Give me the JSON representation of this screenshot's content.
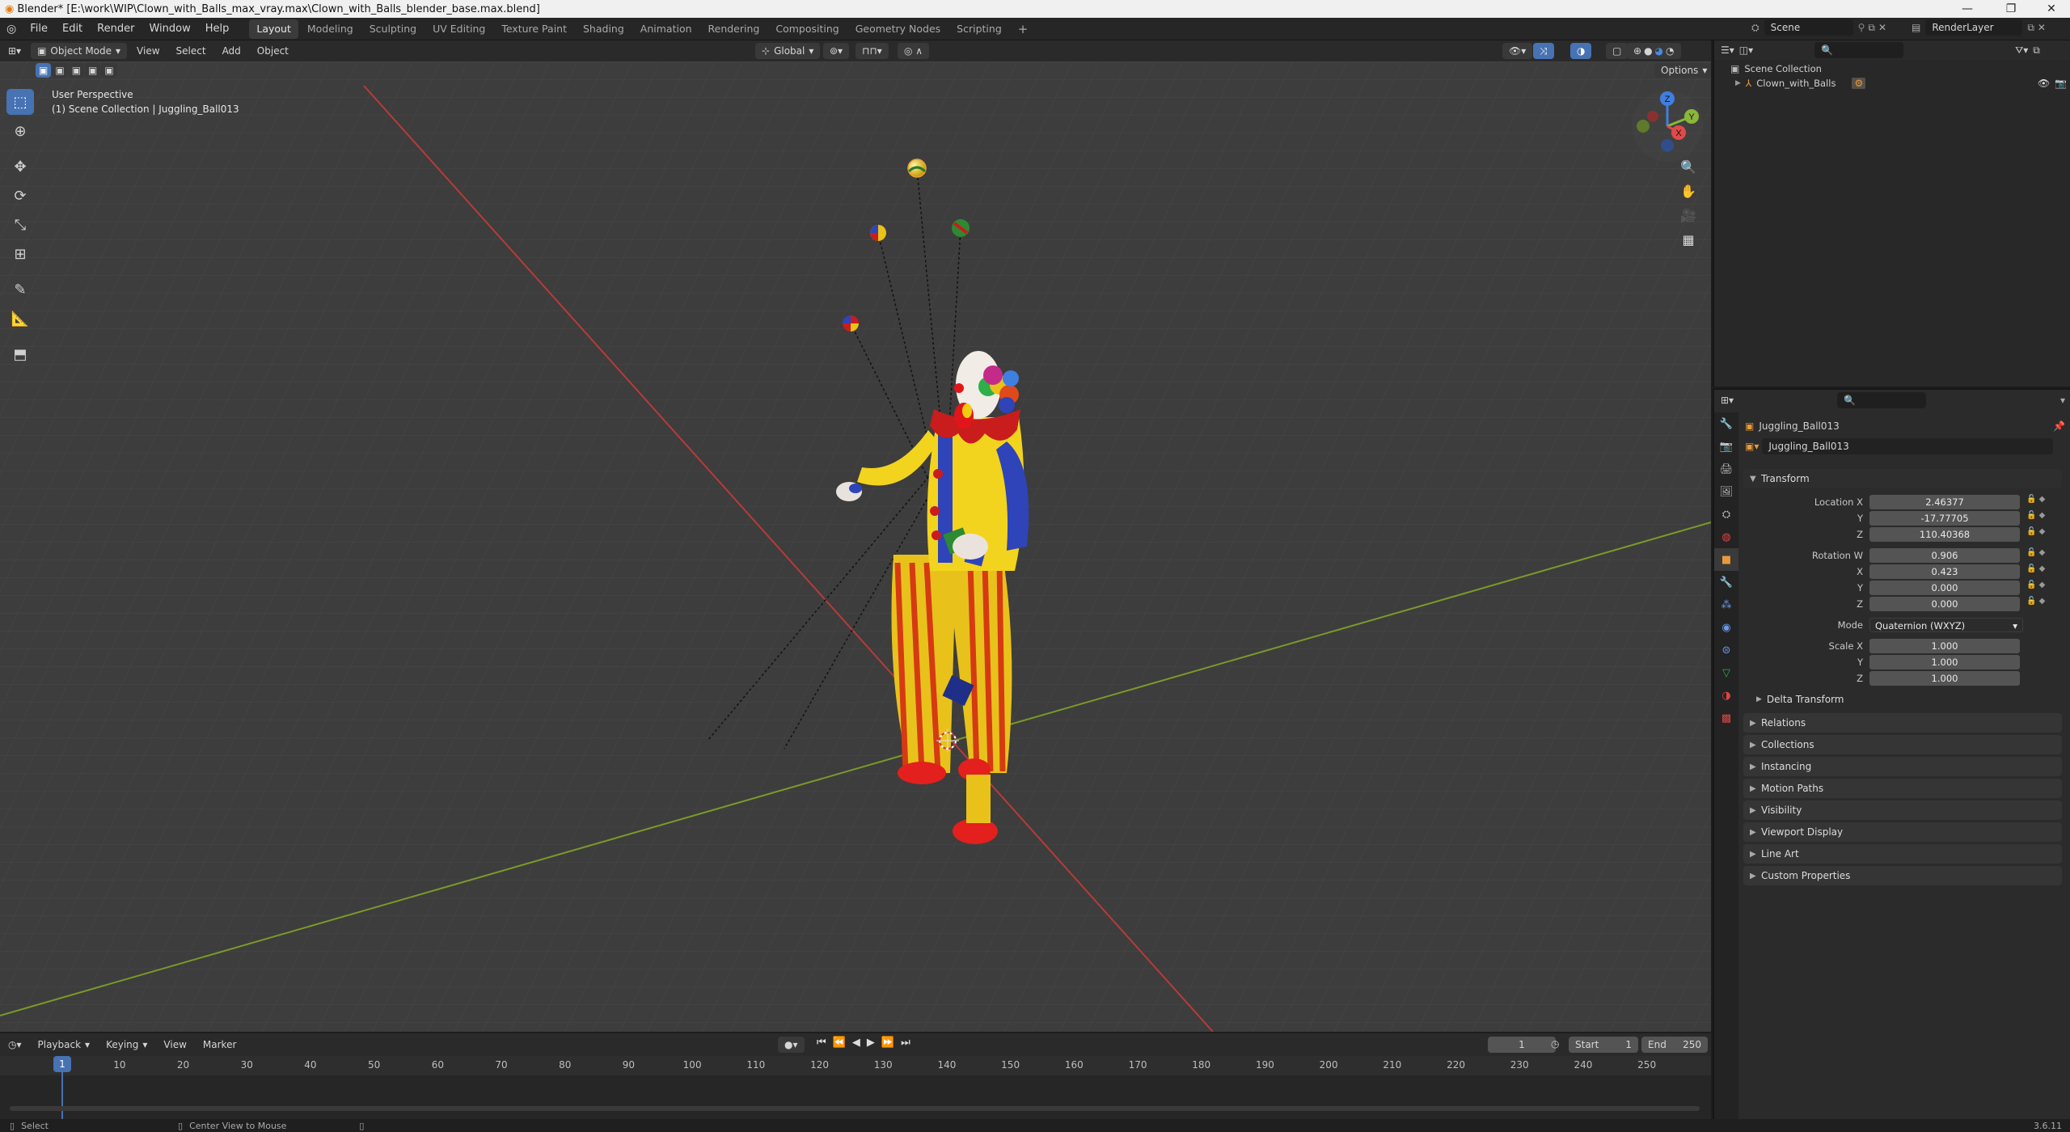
{
  "window": {
    "title": "Blender* [E:\\work\\WIP\\Clown_with_Balls_max_vray.max\\Clown_with_Balls_blender_base.max.blend]"
  },
  "menus": [
    "File",
    "Edit",
    "Render",
    "Window",
    "Help"
  ],
  "workspaces": [
    {
      "label": "Layout",
      "active": true
    },
    {
      "label": "Modeling",
      "active": false
    },
    {
      "label": "Sculpting",
      "active": false
    },
    {
      "label": "UV Editing",
      "active": false
    },
    {
      "label": "Texture Paint",
      "active": false
    },
    {
      "label": "Shading",
      "active": false
    },
    {
      "label": "Animation",
      "active": false
    },
    {
      "label": "Rendering",
      "active": false
    },
    {
      "label": "Compositing",
      "active": false
    },
    {
      "label": "Geometry Nodes",
      "active": false
    },
    {
      "label": "Scripting",
      "active": false
    }
  ],
  "scene_selector": {
    "scene": "Scene",
    "layer": "RenderLayer"
  },
  "viewport_header": {
    "mode": "Object Mode",
    "menus": [
      "View",
      "Select",
      "Add",
      "Object"
    ],
    "orientation": "Global",
    "options": "Options"
  },
  "viewport": {
    "overlay_line1": "User Perspective",
    "overlay_line2": "(1) Scene Collection | Juggling_Ball013",
    "gizmo_axes": [
      "X",
      "Y",
      "Z"
    ],
    "colors": {
      "x_axis": "#b83a3a",
      "y_axis": "#7a9a2a",
      "grid": "#484848",
      "bg": "#3d3d3d"
    }
  },
  "outliner": {
    "root": "Scene Collection",
    "items": [
      {
        "label": "Clown_with_Balls"
      }
    ]
  },
  "properties": {
    "object_name": "Juggling_Ball013",
    "datablock": "Juggling_Ball013",
    "transform_title": "Transform",
    "location": {
      "label": "Location X",
      "x": "2.46377",
      "y": "-17.77705",
      "z": "110.40368"
    },
    "rotation": {
      "label": "Rotation W",
      "w": "0.906",
      "x": "0.423",
      "y": "0.000",
      "z": "0.000"
    },
    "mode": {
      "label": "Mode",
      "value": "Quaternion (WXYZ)"
    },
    "scale": {
      "label": "Scale X",
      "x": "1.000",
      "y": "1.000",
      "z": "1.000"
    },
    "axis_labels": {
      "x": "X",
      "y": "Y",
      "z": "Z",
      "w": "W"
    },
    "delta": "Delta Transform",
    "panels": [
      "Relations",
      "Collections",
      "Instancing",
      "Motion Paths",
      "Visibility",
      "Viewport Display",
      "Line Art",
      "Custom Properties"
    ]
  },
  "timeline": {
    "menus": [
      "Playback",
      "Keying",
      "View",
      "Marker"
    ],
    "current_frame": "1",
    "start_label": "Start",
    "start": "1",
    "end_label": "End",
    "end": "250",
    "ticks": [
      "1",
      "10",
      "20",
      "30",
      "40",
      "50",
      "60",
      "70",
      "80",
      "90",
      "100",
      "110",
      "120",
      "130",
      "140",
      "150",
      "160",
      "170",
      "180",
      "190",
      "200",
      "210",
      "220",
      "230",
      "240",
      "250"
    ]
  },
  "statusbar": {
    "left": "Select",
    "middle": "Center View to Mouse",
    "version": "3.6.11"
  }
}
